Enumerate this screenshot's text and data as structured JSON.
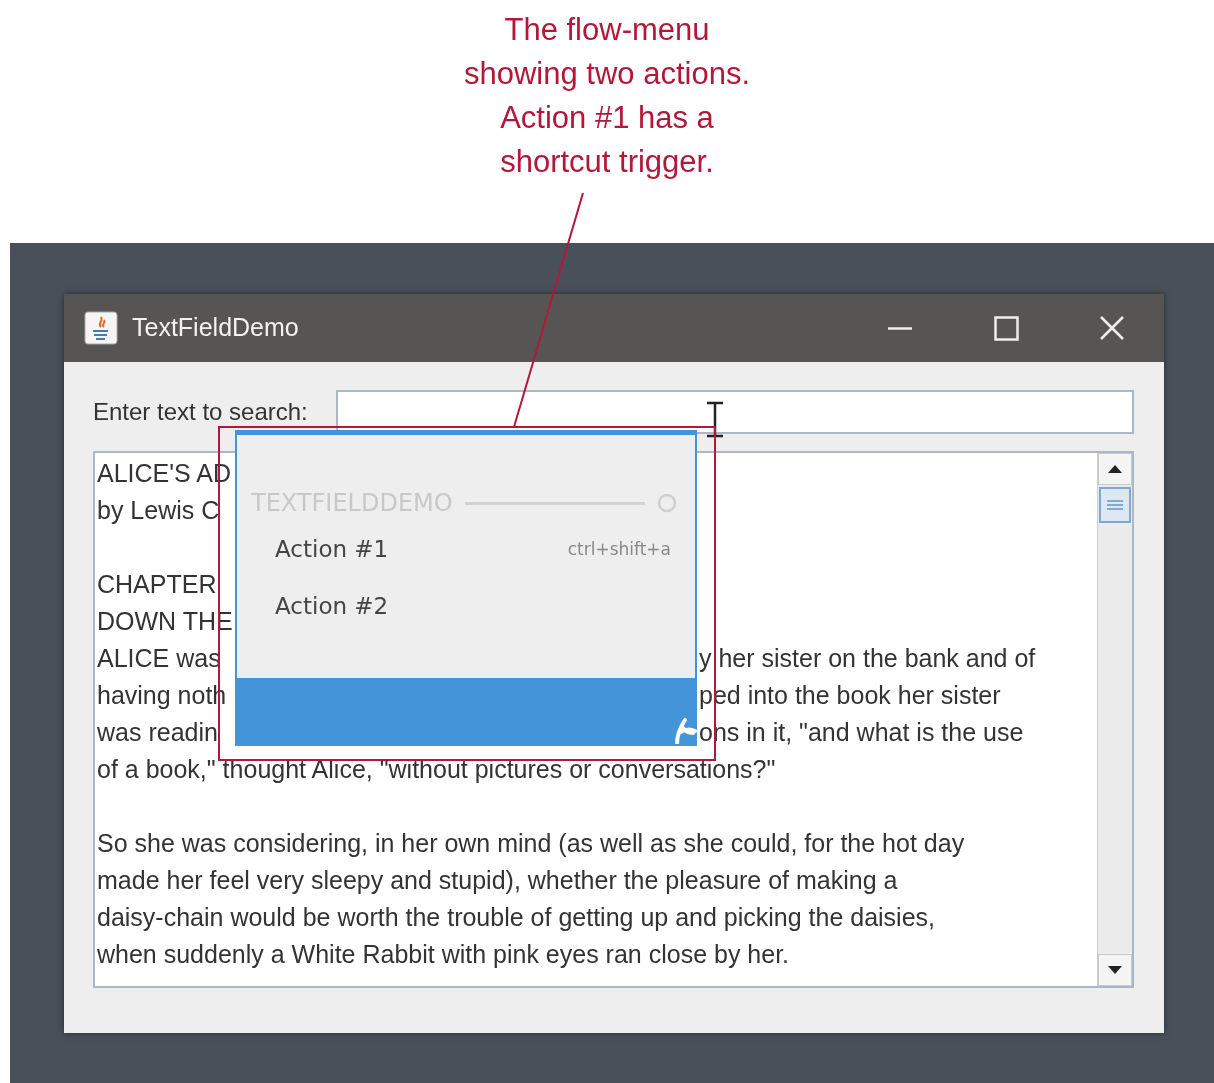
{
  "annotation": {
    "text": "The flow-menu\nshowing two actions.\nAction #1 has a\nshortcut trigger."
  },
  "window": {
    "title": "TextFieldDemo"
  },
  "search": {
    "label": "Enter text to search:"
  },
  "text_area": {
    "lines": [
      {
        "kind": "text",
        "left": "ALICE'S AD"
      },
      {
        "kind": "text",
        "left": "by Lewis C"
      },
      {
        "kind": "blank"
      },
      {
        "kind": "text",
        "left": "CHAPTER"
      },
      {
        "kind": "text",
        "left": "DOWN THE"
      },
      {
        "kind": "text",
        "left": "ALICE was",
        "right": "y her sister on the bank and of"
      },
      {
        "kind": "text",
        "left": "having noth",
        "right": "ped into the book her sister"
      },
      {
        "kind": "text",
        "left": "was readin",
        "right": "ons in it, \"and what is the use"
      },
      {
        "kind": "text",
        "left": "of a book,\" thought Alice, \"without pictures or conversations?\""
      },
      {
        "kind": "blank"
      },
      {
        "kind": "text",
        "left": "So she was considering, in her own mind (as well as she could, for the hot day"
      },
      {
        "kind": "text",
        "left": "made her feel very sleepy and stupid), whether the pleasure of making a"
      },
      {
        "kind": "text",
        "left": "daisy-chain would be worth the trouble of getting up and picking the daisies,"
      },
      {
        "kind": "text",
        "left": "when suddenly a White Rabbit with pink eyes ran close by her."
      }
    ]
  },
  "flow_menu": {
    "header": "TEXTFIELDDEMO",
    "actions": [
      {
        "label": "Action #1",
        "shortcut": "ctrl+shift+a"
      },
      {
        "label": "Action #2"
      }
    ]
  }
}
